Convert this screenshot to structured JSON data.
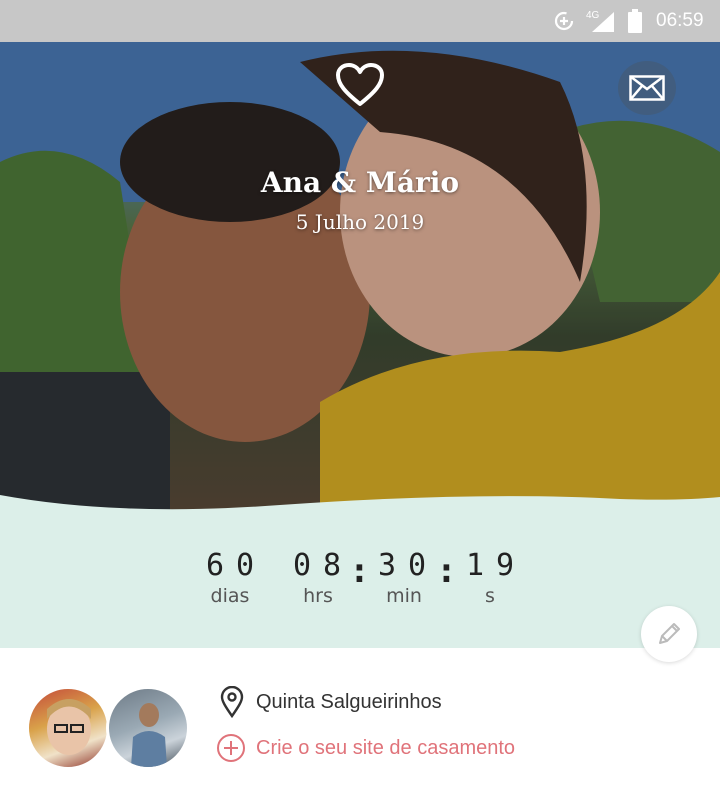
{
  "status_bar": {
    "time": "06:59",
    "network": "4G",
    "icons": [
      "data-saver-icon",
      "signal-icon",
      "battery-icon"
    ]
  },
  "hero": {
    "title": "Ana & Mário",
    "date": "5 Julho 2019",
    "icons": {
      "top": "heart-icon",
      "right": "mail-icon"
    }
  },
  "countdown": {
    "days": "60",
    "hours": "08",
    "minutes": "30",
    "seconds": "19",
    "labels": {
      "days": "dias",
      "hours": "hrs",
      "minutes": "min",
      "seconds": "s"
    },
    "separator": ":"
  },
  "venue": {
    "name": "Quinta Salgueirinhos",
    "icon": "location-pin-icon"
  },
  "cta": {
    "label": "Crie o seu site de casamento",
    "icon": "plus-circle-icon"
  },
  "colors": {
    "countdown_band": "#dcefe9",
    "cta": "#e0737a",
    "status_bar": "#c7c7c7"
  }
}
